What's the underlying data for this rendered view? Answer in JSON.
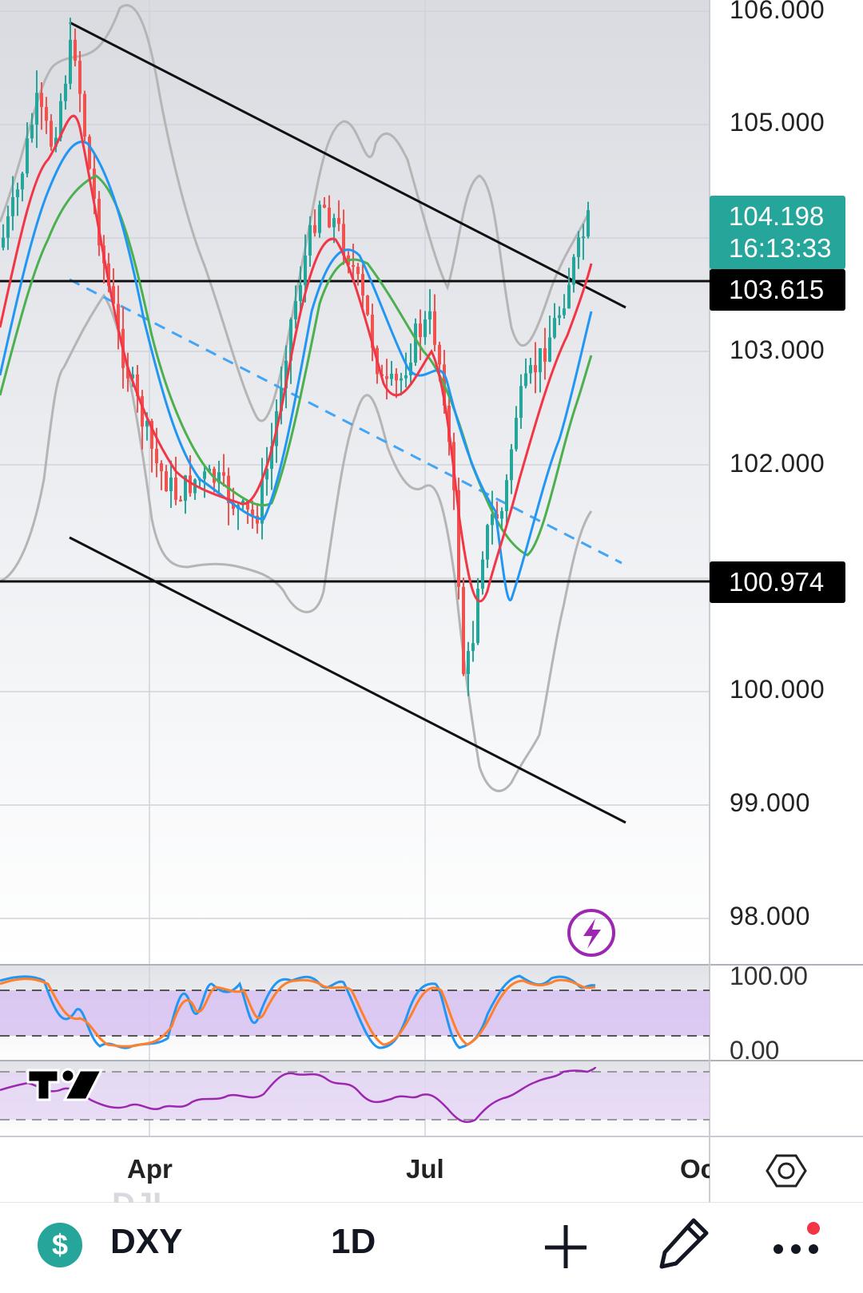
{
  "price_axis": {
    "labels": [
      "106.000",
      "105.000",
      "103.000",
      "102.000",
      "100.000",
      "99.000",
      "98.000"
    ],
    "current_price": "104.198",
    "countdown": "16:13:33",
    "hline_upper": "103.615",
    "hline_lower": "100.974",
    "current_badge_color": "#26a69a"
  },
  "oscillator_axis": {
    "top": "100.00",
    "bottom": "0.00"
  },
  "time_axis": {
    "labels": [
      "Apr",
      "Jul",
      "Oc"
    ]
  },
  "watermark_text": "DJI",
  "bottom_bar": {
    "symbol": "DXY",
    "interval": "1D",
    "symbol_icon_text": "$",
    "symbol_icon_color": "#26a69a",
    "notification_dot_color": "#f23645"
  },
  "icons": {
    "alert": "lightning-icon",
    "settings": "hexagon-settings-icon",
    "add": "plus-icon",
    "draw": "pencil-icon",
    "more": "more-dots-icon",
    "logo": "tradingview-logo"
  },
  "colors": {
    "candle_up": "#26a69a",
    "candle_down": "#ef5350",
    "ma_fast": "#f23645",
    "ma_mid": "#2196f3",
    "ma_slow": "#4caf50",
    "bollinger": "#b5b5b5",
    "channel_mid": "#42a5f5",
    "stoch_k": "#2196f3",
    "stoch_d": "#ff7f2a",
    "rsi": "#9c27b0",
    "alert_icon": "#9c27b0"
  }
}
